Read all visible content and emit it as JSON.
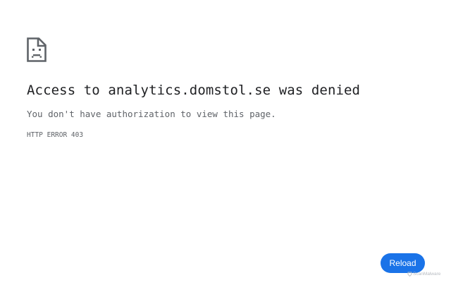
{
  "error": {
    "icon": "sad-document-icon",
    "title": "Access to analytics.domstol.se was denied",
    "message": "You don't have authorization to view this page.",
    "code": "HTTP ERROR 403"
  },
  "actions": {
    "reload_label": "Reload"
  },
  "watermark": {
    "text": "ScanMalware"
  },
  "colors": {
    "title": "#202124",
    "text": "#5f6368",
    "icon": "#5f6368",
    "button": "#1a73e8",
    "button_text": "#ffffff",
    "background": "#ffffff"
  }
}
